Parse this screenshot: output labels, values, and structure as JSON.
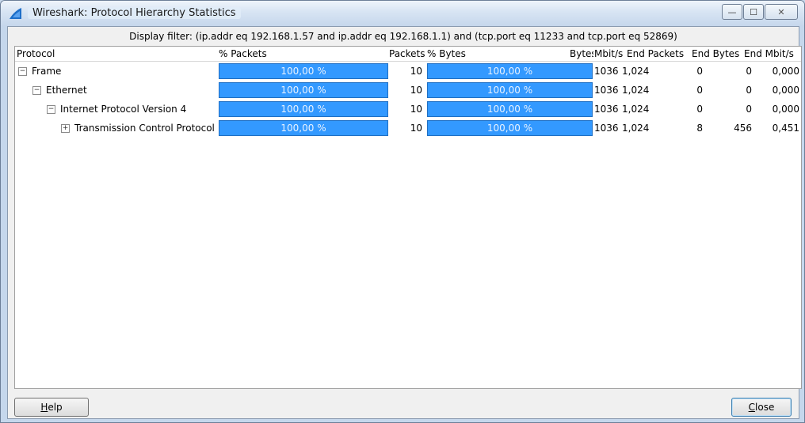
{
  "window": {
    "title": "Wireshark: Protocol Hierarchy Statistics",
    "controls": {
      "minimize": "—",
      "maximize": "☐",
      "close": "✕"
    }
  },
  "filter_text": "Display filter: (ip.addr eq 192.168.1.57 and ip.addr eq 192.168.1.1) and (tcp.port eq 11233 and tcp.port eq 52869)",
  "table": {
    "headers": {
      "protocol": "Protocol",
      "pct_packets": "% Packets",
      "packets": "Packets",
      "pct_bytes": "% Bytes",
      "bytes": "Bytes",
      "mbit": "Mbit/s",
      "end_packets": "End Packets",
      "end_bytes": "End Bytes",
      "end_mbit": "End Mbit/s"
    },
    "rows": [
      {
        "toggle": "−",
        "name": "Frame",
        "pct_packets": "100,00 %",
        "packets": "10",
        "pct_bytes": "100,00 %",
        "bytes": "1036",
        "mbit": "1,024",
        "end_packets": "0",
        "end_bytes": "0",
        "end_mbit": "0,000"
      },
      {
        "toggle": "−",
        "name": "Ethernet",
        "pct_packets": "100,00 %",
        "packets": "10",
        "pct_bytes": "100,00 %",
        "bytes": "1036",
        "mbit": "1,024",
        "end_packets": "0",
        "end_bytes": "0",
        "end_mbit": "0,000"
      },
      {
        "toggle": "−",
        "name": "Internet Protocol Version 4",
        "pct_packets": "100,00 %",
        "packets": "10",
        "pct_bytes": "100,00 %",
        "bytes": "1036",
        "mbit": "1,024",
        "end_packets": "0",
        "end_bytes": "0",
        "end_mbit": "0,000"
      },
      {
        "toggle": "+",
        "name": "Transmission Control Protocol",
        "pct_packets": "100,00 %",
        "packets": "10",
        "pct_bytes": "100,00 %",
        "bytes": "1036",
        "mbit": "1,024",
        "end_packets": "8",
        "end_bytes": "456",
        "end_mbit": "0,451"
      }
    ]
  },
  "buttons": {
    "help": {
      "pre": "",
      "key": "H",
      "post": "elp"
    },
    "close": {
      "pre": "",
      "key": "C",
      "post": "lose"
    }
  },
  "colors": {
    "bar_fill": "#3399ff",
    "bar_border": "#1f6fc4"
  }
}
